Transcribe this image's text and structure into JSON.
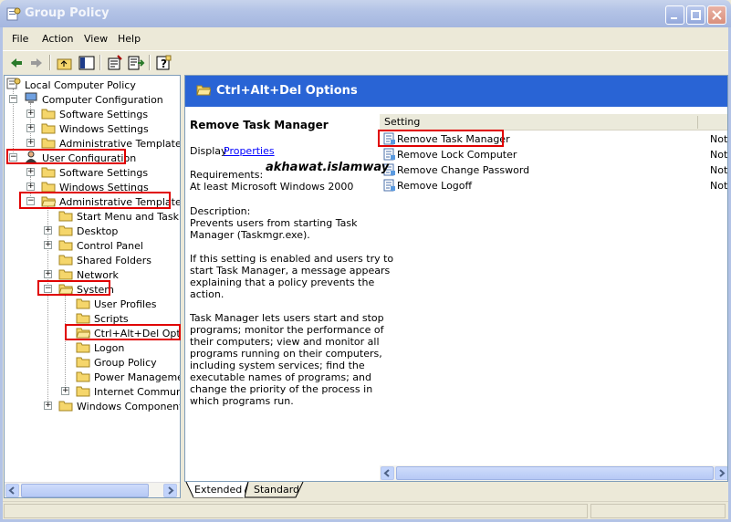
{
  "window": {
    "title": "Group Policy"
  },
  "menu": [
    "File",
    "Action",
    "View",
    "Help"
  ],
  "tree": {
    "root": "Local Computer Policy",
    "computer_configuration": "Computer Configuration",
    "cc_software_settings": "Software Settings",
    "cc_windows_settings": "Windows Settings",
    "cc_admin_templates": "Administrative Templates",
    "user_configuration": "User Configuration",
    "uc_software_settings": "Software Settings",
    "uc_windows_settings": "Windows Settings",
    "uc_admin_templates": "Administrative Templates",
    "start_menu": "Start Menu and Taskbar",
    "desktop": "Desktop",
    "control_panel": "Control Panel",
    "shared_folders": "Shared Folders",
    "network": "Network",
    "system": "System",
    "user_profiles": "User Profiles",
    "scripts": "Scripts",
    "ctrl_alt_del": "Ctrl+Alt+Del Options",
    "logon": "Logon",
    "group_policy": "Group Policy",
    "power_management": "Power Management",
    "internet_communication": "Internet Communication Management",
    "windows_components": "Windows Components"
  },
  "right": {
    "header_title": "Ctrl+Alt+Del Options",
    "setting_title": "Remove Task Manager",
    "display_label": "Display",
    "properties_link": "Properties",
    "requirements_label": "Requirements:",
    "requirements_value": "At least Microsoft Windows 2000",
    "description_label": "Description:",
    "desc_lines": [
      "Prevents users from starting Task",
      "Manager (Taskmgr.exe).",
      "",
      "If this setting is enabled and users try to",
      "start Task Manager, a message appears",
      "explaining that a policy prevents the",
      "action.",
      "",
      "Task Manager lets users start and stop",
      "programs; monitor the performance of",
      "their computers; view and monitor all",
      "programs running on their computers,",
      "including system services; find the",
      "executable names of programs; and",
      "change the priority of the process in",
      "which programs run."
    ],
    "watermark": "akhawat.islamway",
    "column_setting": "Setting",
    "rows": [
      {
        "name": "Remove Task Manager",
        "state": "Not"
      },
      {
        "name": "Remove Lock Computer",
        "state": "Not"
      },
      {
        "name": "Remove Change Password",
        "state": "Not"
      },
      {
        "name": "Remove Logoff",
        "state": "Not"
      }
    ]
  },
  "tabs": {
    "extended": "Extended",
    "standard": "Standard"
  },
  "colors": {
    "header_blue": "#2964d5",
    "highlight_red": "#e00000",
    "folder_yellow": "#f5d66b"
  }
}
